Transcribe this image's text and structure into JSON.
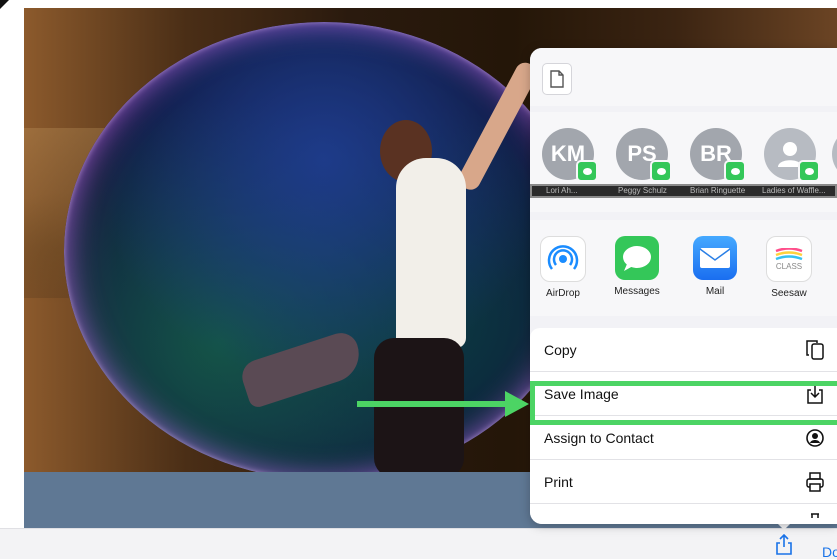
{
  "people": [
    {
      "initials": "KM",
      "name": "Lori Ah..."
    },
    {
      "initials": "PS",
      "name": "Peggy Schulz"
    },
    {
      "initials": "BR",
      "name": "Brian Ringuette"
    },
    {
      "initials": "",
      "name": "Ladies of Waffle..."
    }
  ],
  "apps": [
    {
      "label": "AirDrop",
      "icon": "airdrop-icon",
      "color": "#1a8cff"
    },
    {
      "label": "Messages",
      "icon": "messages-icon",
      "color": "#34c759"
    },
    {
      "label": "Mail",
      "icon": "mail-icon",
      "color": "#2f8cf5"
    },
    {
      "label": "Seesaw",
      "icon": "seesaw-icon",
      "color": "#ffffff",
      "badge": "CLASS"
    }
  ],
  "actions": [
    {
      "label": "Copy",
      "icon": "copy-icon"
    },
    {
      "label": "Save Image",
      "icon": "save-image-icon"
    },
    {
      "label": "Assign to Contact",
      "icon": "contact-icon"
    },
    {
      "label": "Print",
      "icon": "print-icon"
    }
  ],
  "toolbar": {
    "done_label": "Done"
  },
  "colors": {
    "accent": "#1a73e8",
    "highlight": "#4cd464",
    "messages_badge": "#34c759"
  }
}
